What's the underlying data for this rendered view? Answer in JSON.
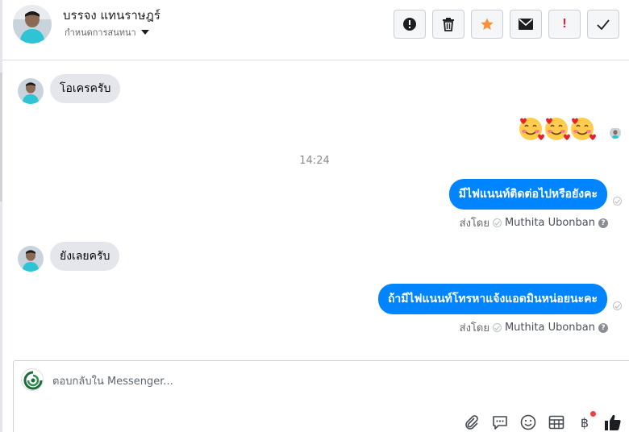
{
  "header": {
    "name": "บรรจง แทนราษฎร์",
    "subtitle": "กำหนดการสนทนา",
    "toolbar": {
      "spam": "!",
      "delete": "delete",
      "star": "star",
      "mail": "mail",
      "important": "!",
      "done": "done"
    }
  },
  "messages": [
    {
      "type": "in",
      "text": "โอเครครับ"
    },
    {
      "type": "in_emoji",
      "text": "🥰🥰🥰"
    },
    {
      "type": "time",
      "text": "14:24"
    },
    {
      "type": "out",
      "text": "มีไฟแนนท์ติดต่อไปหรือยังคะ",
      "sent_prefix": "ส่งโดย",
      "sent_by": "Muthita Ubonban"
    },
    {
      "type": "in",
      "text": "ยังเลยครับ"
    },
    {
      "type": "out",
      "text": "ถ้ามีไฟแนนท์โทรหาแจ้งแอดมินหน่อยนะคะ",
      "sent_prefix": "ส่งโดย",
      "sent_by": "Muthita Ubonban"
    }
  ],
  "composer": {
    "placeholder": "ตอบกลับใน Messenger...",
    "tools": [
      "paperclip-icon",
      "saved-replies-icon",
      "emoji-icon",
      "table-icon",
      "baht-icon",
      "like-icon"
    ],
    "baht_symbol": "฿"
  },
  "colors": {
    "accent": "#0084ff",
    "incoming": "#e4e6eb",
    "star": "#f7923b",
    "alert": "#e41e3f"
  }
}
